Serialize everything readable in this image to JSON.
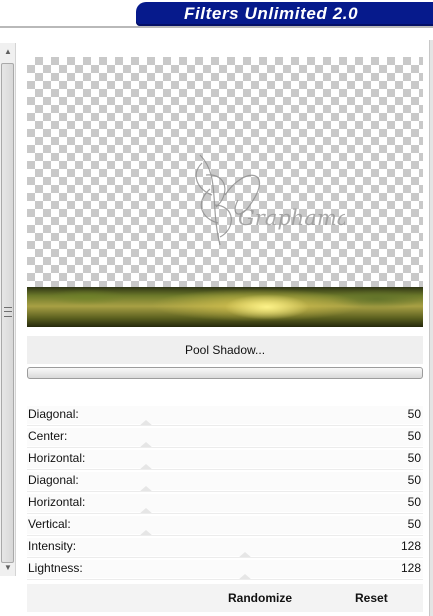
{
  "header": {
    "title": "Filters Unlimited 2.0"
  },
  "filter": {
    "name": "Pool Shadow..."
  },
  "preview": {
    "watermark_text": "Graphamania"
  },
  "parameters": [
    {
      "label": "Diagonal:",
      "value": "50",
      "fraction": 0.3
    },
    {
      "label": "Center:",
      "value": "50",
      "fraction": 0.3
    },
    {
      "label": "Horizontal:",
      "value": "50",
      "fraction": 0.3
    },
    {
      "label": "Diagonal:",
      "value": "50",
      "fraction": 0.3
    },
    {
      "label": "Horizontal:",
      "value": "50",
      "fraction": 0.3
    },
    {
      "label": "Vertical:",
      "value": "50",
      "fraction": 0.3
    },
    {
      "label": "Intensity:",
      "value": "128",
      "fraction": 0.55
    },
    {
      "label": "Lightness:",
      "value": "128",
      "fraction": 0.55
    }
  ],
  "buttons": {
    "randomize": "Randomize",
    "reset": "Reset"
  },
  "colors": {
    "banner": "#061a8c",
    "checker": "#c9c9c9"
  }
}
